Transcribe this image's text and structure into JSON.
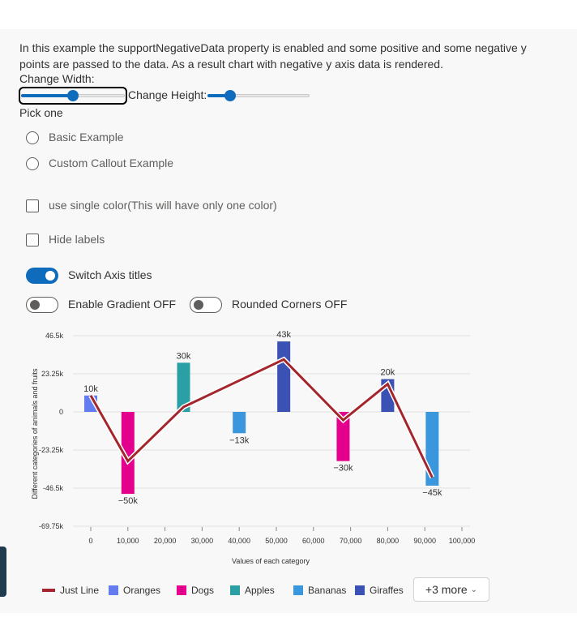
{
  "description": "In this example the supportNegativeData property is enabled and some positive and some negative y points are passed to the data. As a result chart with negative y axis data is rendered.",
  "controls": {
    "width_label": "Change Width:",
    "height_label": "Change Height:",
    "width_value": 0.5,
    "height_value": 0.22,
    "pick_label": "Pick one",
    "radio_options": [
      "Basic Example",
      "Custom Callout Example"
    ],
    "checkboxes": [
      "use single color(This will have only one color)",
      "Hide labels"
    ],
    "toggles": {
      "axis_titles": {
        "label": "Switch Axis titles",
        "on": true
      },
      "gradient": {
        "label": "Enable Gradient OFF",
        "on": false
      },
      "rounded": {
        "label": "Rounded Corners OFF",
        "on": false
      }
    }
  },
  "chart_data": {
    "type": "bar",
    "xlabel": "Values of each category",
    "ylabel": "Different categories of animals and fruits",
    "x_ticks": [
      "0",
      "10,000",
      "20,000",
      "30,000",
      "40,000",
      "50,000",
      "60,000",
      "70,000",
      "80,000",
      "90,000",
      "100,000"
    ],
    "y_ticks": [
      "46.5k",
      "23.25k",
      "0",
      "-23.25k",
      "-46.5k",
      "-69.75k"
    ],
    "y_tick_values": [
      46500,
      23250,
      0,
      -23250,
      -46500,
      -69750
    ],
    "ylim": [
      -69750,
      46500
    ],
    "xlim": [
      -5000,
      105000
    ],
    "grid": true,
    "bars": [
      {
        "x": 0,
        "y": 10000,
        "label": "10k",
        "color": "#637cef"
      },
      {
        "x": 10000,
        "y": -50000,
        "label": "−50k",
        "color": "#e3008c"
      },
      {
        "x": 25000,
        "y": 30000,
        "label": "30k",
        "color": "#2aa0a4"
      },
      {
        "x": 40000,
        "y": -13000,
        "label": "−13k",
        "color": "#3a96dd"
      },
      {
        "x": 52000,
        "y": 43000,
        "label": "43k",
        "color": "#3c51b4"
      },
      {
        "x": 68000,
        "y": -30000,
        "label": "−30k",
        "color": "#e3008c"
      },
      {
        "x": 80000,
        "y": 20000,
        "label": "20k",
        "color": "#3c51b4"
      },
      {
        "x": 92000,
        "y": -45000,
        "label": "−45k",
        "color": "#3a96dd"
      }
    ],
    "line": {
      "name": "Just Line",
      "color": "#a4262c",
      "points": [
        [
          0,
          10000
        ],
        [
          10000,
          -30000
        ],
        [
          25000,
          3000
        ],
        [
          52000,
          32000
        ],
        [
          68000,
          -5000
        ],
        [
          80000,
          17000
        ],
        [
          92000,
          -40000
        ]
      ]
    },
    "legend": [
      {
        "name": "Just Line",
        "color": "#a4262c",
        "kind": "line"
      },
      {
        "name": "Oranges",
        "color": "#637cef",
        "kind": "box"
      },
      {
        "name": "Dogs",
        "color": "#e3008c",
        "kind": "box"
      },
      {
        "name": "Apples",
        "color": "#2aa0a4",
        "kind": "box"
      },
      {
        "name": "Bananas",
        "color": "#3a96dd",
        "kind": "box"
      },
      {
        "name": "Giraffes",
        "color": "#3c51b4",
        "kind": "box"
      }
    ],
    "legend_more": "+3 more"
  }
}
